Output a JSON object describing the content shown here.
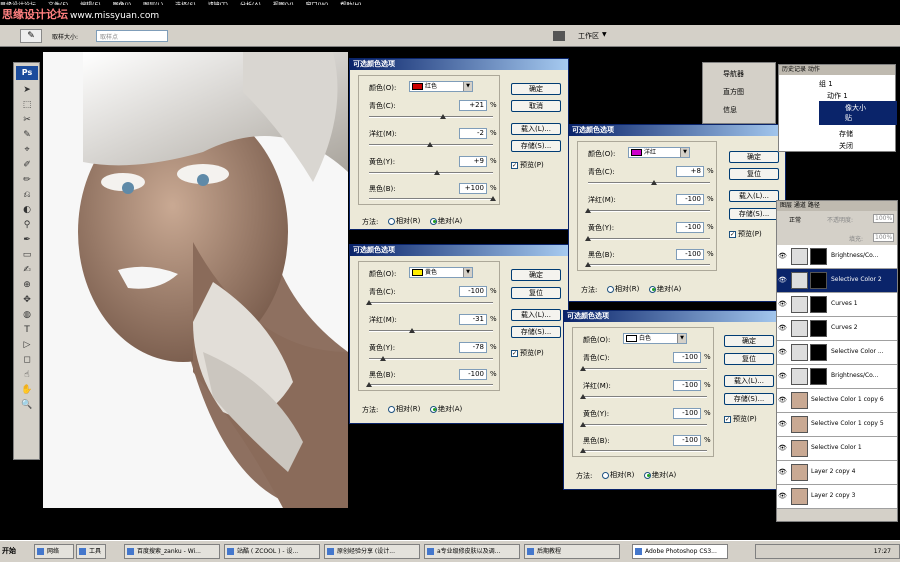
{
  "menu": [
    "思缘设计论坛",
    "文件(F)",
    "编辑(E)",
    "图像(I)",
    "图层(L)",
    "选择(S)",
    "滤镜(T)",
    "分析(A)",
    "视图(V)",
    "窗口(W)",
    "帮助(H)"
  ],
  "watermark": {
    "text": "思缘设计论坛",
    "url": "www.missyuan.com"
  },
  "options": {
    "sample_label": "取样大小:",
    "sample_value": "取样点",
    "workspace": "工作区"
  },
  "toolbox": {
    "logo": "Ps"
  },
  "dialogs": [
    {
      "title": "可选颜色选项",
      "color_label": "颜色(O):",
      "color_name": "红色",
      "color_hex": "#cc0000",
      "rows": [
        {
          "label": "青色(C):",
          "value": "+21",
          "pos": 0.6
        },
        {
          "label": "洋红(M):",
          "value": "-2",
          "pos": 0.49
        },
        {
          "label": "黄色(Y):",
          "value": "+9",
          "pos": 0.55
        },
        {
          "label": "黑色(B):",
          "value": "+100",
          "pos": 1.0
        }
      ],
      "buttons": [
        "确定",
        "取消",
        "载入(L)...",
        "存储(S)..."
      ],
      "preview": "预览(P)",
      "method_label": "方法:",
      "relative": "相对(R)",
      "absolute": "绝对(A)"
    },
    {
      "title": "可选颜色选项",
      "color_label": "颜色(O):",
      "color_name": "黄色",
      "color_hex": "#ffee00",
      "rows": [
        {
          "label": "青色(C):",
          "value": "-100",
          "pos": 0.0
        },
        {
          "label": "洋红(M):",
          "value": "-31",
          "pos": 0.35
        },
        {
          "label": "黄色(Y):",
          "value": "-78",
          "pos": 0.11
        },
        {
          "label": "黑色(B):",
          "value": "-100",
          "pos": 0.0
        }
      ],
      "buttons": [
        "确定",
        "复位",
        "载入(L)...",
        "存储(S)..."
      ],
      "preview": "预览(P)",
      "method_label": "方法:",
      "relative": "相对(R)",
      "absolute": "绝对(A)"
    },
    {
      "title": "可选颜色选项",
      "color_label": "颜色(O):",
      "color_name": "洋红",
      "color_hex": "#cc00cc",
      "rows": [
        {
          "label": "青色(C):",
          "value": "+8",
          "pos": 0.54
        },
        {
          "label": "洋红(M):",
          "value": "-100",
          "pos": 0.0
        },
        {
          "label": "黄色(Y):",
          "value": "-100",
          "pos": 0.0
        },
        {
          "label": "黑色(B):",
          "value": "-100",
          "pos": 0.0
        }
      ],
      "buttons": [
        "确定",
        "复位",
        "载入(L)...",
        "存储(S)..."
      ],
      "preview": "预览(P)",
      "method_label": "方法:",
      "relative": "相对(R)",
      "absolute": "绝对(A)"
    },
    {
      "title": "可选颜色选项",
      "color_label": "颜色(O):",
      "color_name": "白色",
      "color_hex": "#ffffff",
      "rows": [
        {
          "label": "青色(C):",
          "value": "-100",
          "pos": 0.0
        },
        {
          "label": "洋红(M):",
          "value": "-100",
          "pos": 0.0
        },
        {
          "label": "黄色(Y):",
          "value": "-100",
          "pos": 0.0
        },
        {
          "label": "黑色(B):",
          "value": "-100",
          "pos": 0.0
        }
      ],
      "buttons": [
        "确定",
        "复位",
        "载入(L)...",
        "存储(S)..."
      ],
      "preview": "预览(P)",
      "method_label": "方法:",
      "relative": "相对(R)",
      "absolute": "绝对(A)"
    }
  ],
  "nav_panel": {
    "items": [
      "导航器",
      "直方图",
      "信息"
    ]
  },
  "history_panel": {
    "tabs": "历史记录  动作",
    "items": [
      "组 1",
      "动作 1",
      "像大小",
      "贴",
      "存储",
      "关闭"
    ]
  },
  "layers_panel": {
    "tabs": "图层  通道  路径",
    "blend": "正常",
    "opacity_label": "不透明度:",
    "opacity": "100%",
    "fill_label": "填充:",
    "fill": "100%",
    "layers": [
      {
        "name": "Brightness/Co...",
        "type": "adj",
        "selected": false
      },
      {
        "name": "Selective Color 2",
        "type": "adj",
        "selected": true
      },
      {
        "name": "Curves 1",
        "type": "adj",
        "selected": false
      },
      {
        "name": "Curves 2",
        "type": "adj",
        "selected": false
      },
      {
        "name": "Selective Color ...",
        "type": "adj",
        "selected": false
      },
      {
        "name": "Brightness/Co...",
        "type": "adj",
        "selected": false
      },
      {
        "name": "Selective Color 1 copy 6",
        "type": "px",
        "selected": false
      },
      {
        "name": "Selective Color 1 copy 5",
        "type": "px",
        "selected": false
      },
      {
        "name": "Selective Color 1",
        "type": "px",
        "selected": false
      },
      {
        "name": "Layer 2 copy 4",
        "type": "px",
        "selected": false
      },
      {
        "name": "Layer 2 copy 3",
        "type": "px",
        "selected": false
      }
    ]
  },
  "taskbar": {
    "start": "开始",
    "tasks": [
      "网络",
      "工具",
      "百度搜索_zanku - Wi...",
      "站酷 ( ZCOOL ) - 设...",
      "原创经验分享 (设计...",
      "a专业级修皮肤以及调...",
      "后期教程",
      "Adobe Photoshop CS3..."
    ],
    "clock": "17:27"
  }
}
